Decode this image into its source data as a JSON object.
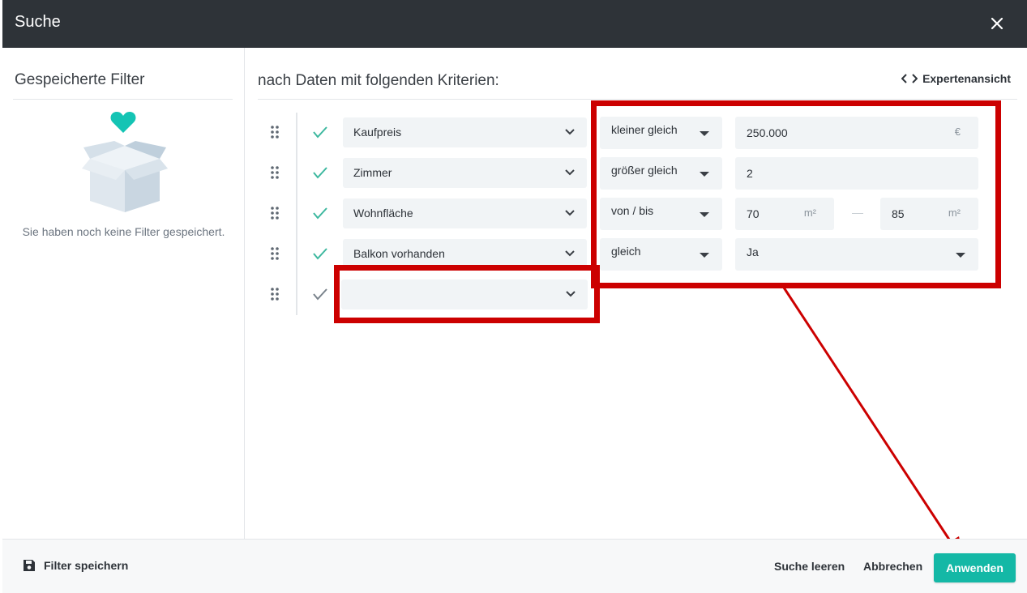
{
  "dialog": {
    "title": "Suche"
  },
  "left_panel": {
    "title": "Gespeicherte Filter",
    "empty_text": "Sie haben noch keine Filter gespeichert."
  },
  "main": {
    "title": "nach Daten mit folgenden Kriterien:",
    "expert_label": "Expertenansicht"
  },
  "rows": [
    {
      "field": "Kaufpreis",
      "operator": "kleiner gleich",
      "value": "250.000",
      "unit": "€"
    },
    {
      "field": "Zimmer",
      "operator": "größer gleich",
      "value": "2"
    },
    {
      "field": "Wohnfläche",
      "operator": "von / bis",
      "value_from": "70",
      "value_to": "85",
      "unit": "m²"
    },
    {
      "field": "Balkon vorhanden",
      "operator": "gleich",
      "value": "Ja"
    },
    {
      "field": ""
    }
  ],
  "footer": {
    "save_filter": "Filter speichern",
    "clear": "Suche leeren",
    "cancel": "Abbrechen",
    "apply": "Anwenden"
  },
  "colors": {
    "titlebar": "#2e3338",
    "accent": "#14b8a6",
    "annotation": "#cc0000"
  }
}
